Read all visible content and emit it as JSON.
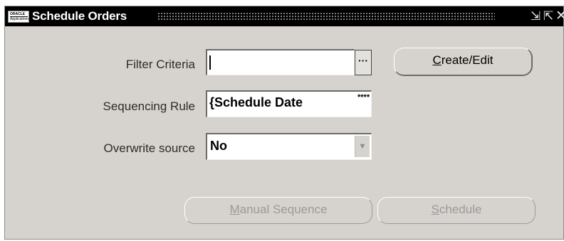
{
  "window": {
    "title": "Schedule Orders",
    "icon": {
      "line1": "ORACLE",
      "line2": "Applications"
    },
    "controls": {
      "minimize": "⇲",
      "maximize": "⇱",
      "close": "✕"
    }
  },
  "form": {
    "filter_criteria": {
      "label": "Filter Criteria",
      "value": "",
      "lov_button": "···"
    },
    "sequencing_rule": {
      "label": "Sequencing Rule",
      "value": "{Schedule Date",
      "overflow_marker": "****"
    },
    "overwrite_source": {
      "label": "Overwrite source",
      "value": "No",
      "arrow": "▼"
    }
  },
  "buttons": {
    "create_edit": {
      "mnemonic": "C",
      "rest": "reate/Edit",
      "enabled": true
    },
    "manual_sequence": {
      "mnemonic": "M",
      "rest": "anual Sequence",
      "enabled": false
    },
    "schedule": {
      "mnemonic": "S",
      "rest": "chedule",
      "enabled": false
    }
  }
}
